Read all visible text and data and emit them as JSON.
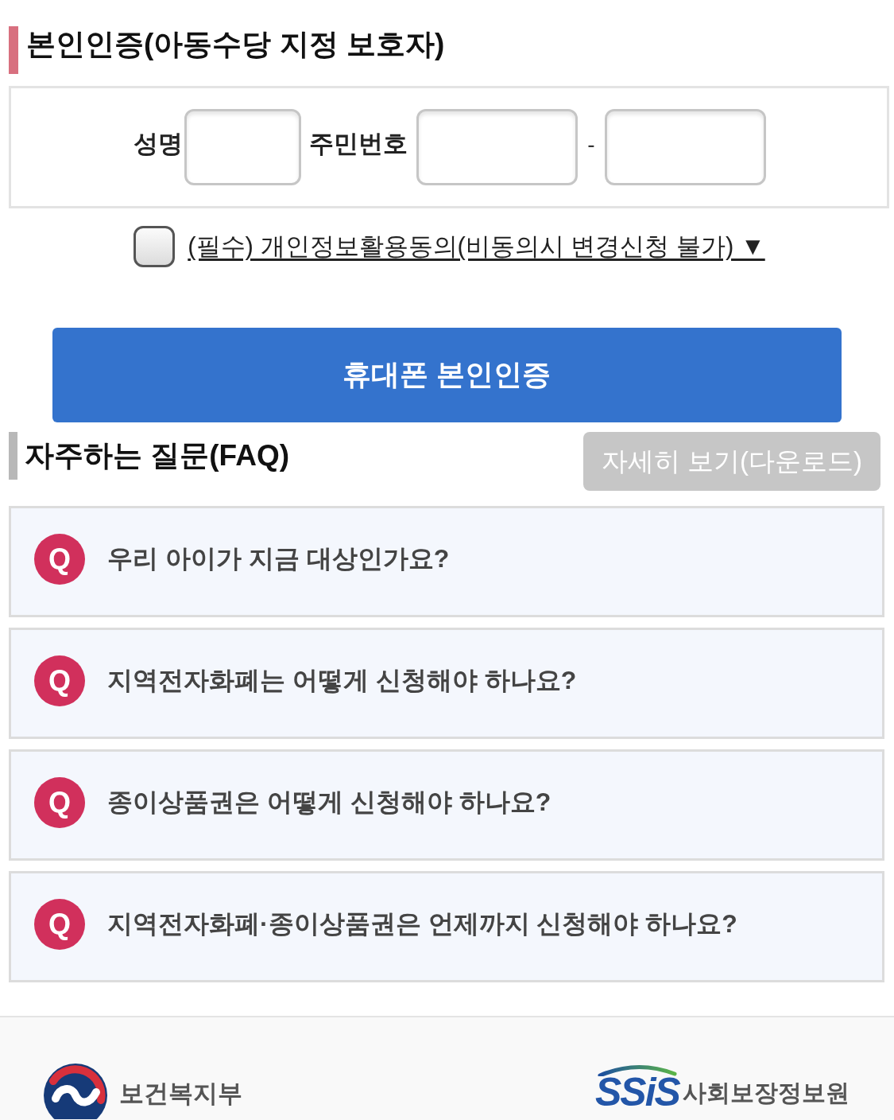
{
  "auth_section": {
    "title": "본인인증(아동수당 지정 보호자)",
    "name_label": "성명",
    "id_label": "주민번호",
    "id_separator": "-"
  },
  "consent": {
    "checked": false,
    "label": "(필수) 개인정보활용동의(비동의시 변경신청 불가) ▼"
  },
  "verify_button": {
    "label": "휴대폰 본인인증"
  },
  "faq": {
    "title": "자주하는 질문(FAQ)",
    "download_button": "자세히 보기(다운로드)",
    "items": [
      {
        "badge": "Q",
        "question": "우리 아이가 지금 대상인가요?"
      },
      {
        "badge": "Q",
        "question": "지역전자화폐는 어떻게 신청해야 하나요?"
      },
      {
        "badge": "Q",
        "question": "종이상품권은 어떻게 신청해야 하나요?"
      },
      {
        "badge": "Q",
        "question": "지역전자화폐·종이상품권은 언제까지 신청해야 하나요?"
      }
    ]
  },
  "footer": {
    "logos": [
      {
        "kind": "emblem",
        "name": "보건복지부"
      },
      {
        "kind": "ssis",
        "mark": "SSiS",
        "name": "사회보장정보원"
      }
    ]
  }
}
